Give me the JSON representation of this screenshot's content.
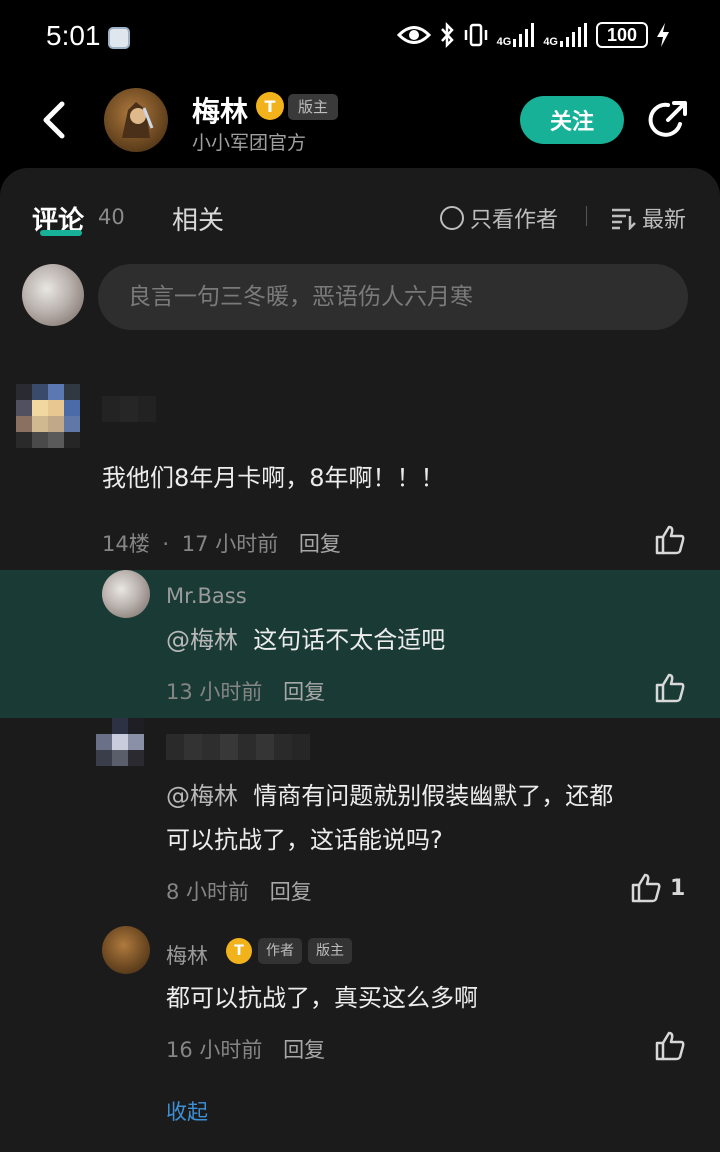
{
  "status_bar": {
    "time": "5:01",
    "battery": "100",
    "network_1": "4G",
    "network_2": "4G"
  },
  "header": {
    "name": "梅林",
    "level": "T",
    "badge": "版主",
    "subtitle": "小小军团官方",
    "follow_label": "关注"
  },
  "tabs": {
    "comments_label": "评论",
    "comments_count": "40",
    "related_label": "相关",
    "author_only_label": "只看作者",
    "sort_label": "最新"
  },
  "comment_input": {
    "placeholder": "良言一句三冬暖，恶语伤人六月寒"
  },
  "comment": {
    "text": "我他们8年月卡啊，8年啊！！！",
    "floor": "14楼",
    "time": "17 小时前",
    "reply_label": "回复"
  },
  "replies": [
    {
      "name": "Mr.Bass",
      "mention": "@梅林",
      "text_lines": [
        "这句话不太合适吧"
      ],
      "time": "13 小时前",
      "reply_label": "回复",
      "likes": ""
    },
    {
      "name": "",
      "mention": "@梅林",
      "text_lines": [
        "情商有问题就别假装幽默了，还都",
        "可以抗战了，这话能说吗?"
      ],
      "time": "8 小时前",
      "reply_label": "回复",
      "likes": "1"
    },
    {
      "name": "梅林",
      "level": "T",
      "badge_author": "作者",
      "badge_mod": "版主",
      "mention": "",
      "text_lines": [
        "都可以抗战了，真买这么多啊"
      ],
      "time": "16 小时前",
      "reply_label": "回复",
      "likes": ""
    }
  ],
  "collapse_label": "收起",
  "colors": {
    "accent": "#17b198",
    "highlight_bg": "#1a3b35",
    "link": "#3d8fd6",
    "level_badge": "#f2b21c"
  },
  "icons": [
    "back-icon",
    "share-icon",
    "radio-icon",
    "sort-icon",
    "thumbs-up-icon",
    "eye-icon",
    "bluetooth-icon",
    "vibrate-icon",
    "signal-icon"
  ]
}
